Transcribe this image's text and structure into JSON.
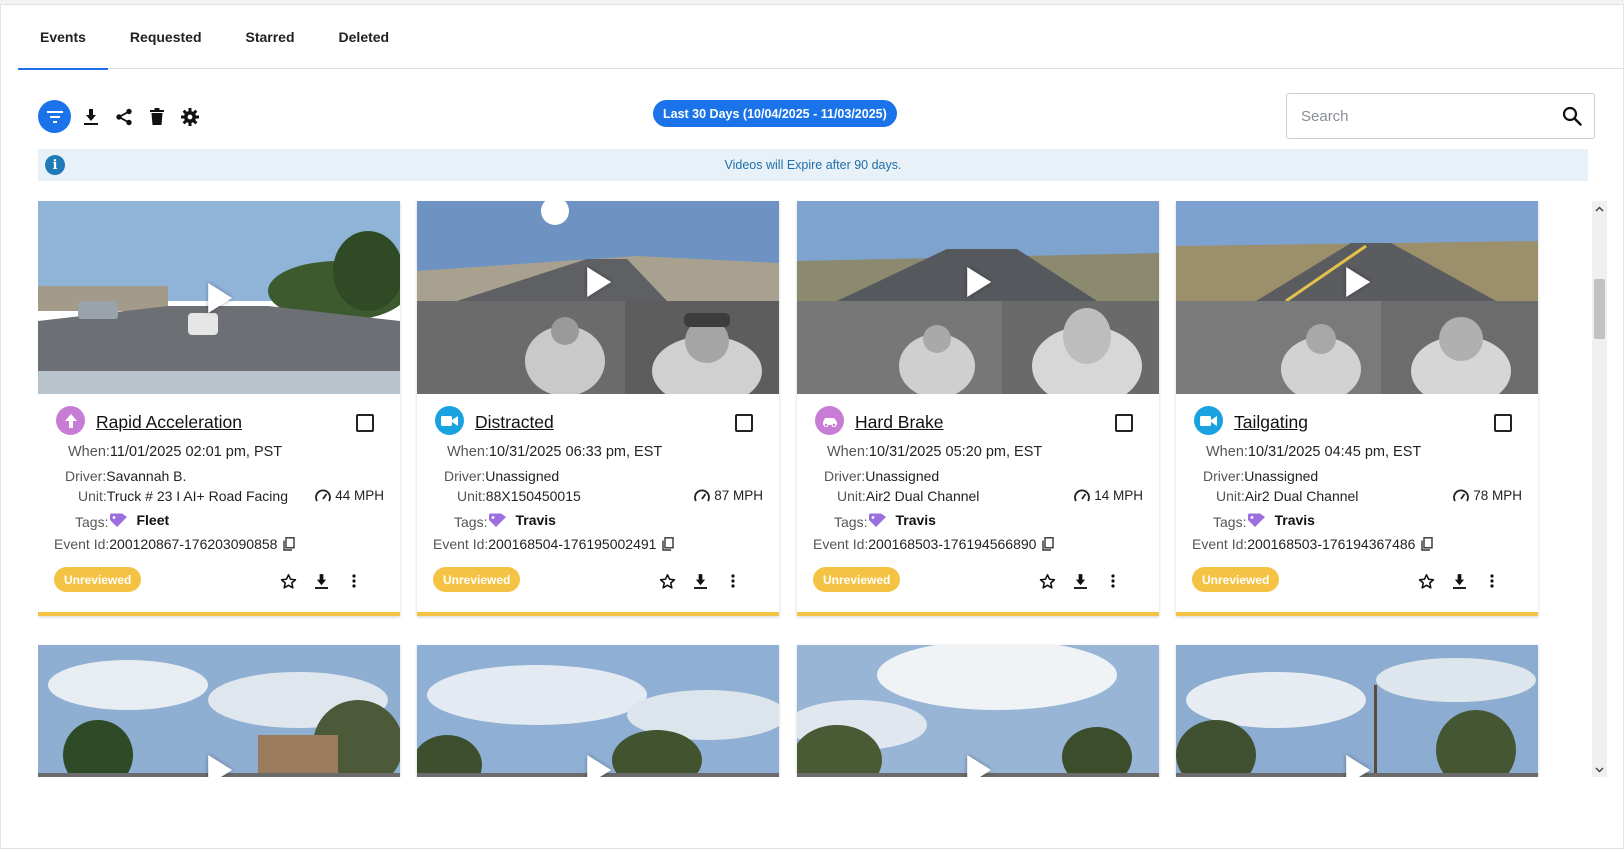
{
  "tabs": [
    {
      "label": "Events",
      "active": true
    },
    {
      "label": "Requested",
      "active": false
    },
    {
      "label": "Starred",
      "active": false
    },
    {
      "label": "Deleted",
      "active": false
    }
  ],
  "toolbar": {
    "icons": [
      "filter-icon",
      "download-icon",
      "share-icon",
      "delete-icon",
      "gear-icon"
    ],
    "date_range": "Last 30 Days (10/04/2025 - 11/03/2025)"
  },
  "search": {
    "placeholder": "Search",
    "value": ""
  },
  "banner": {
    "text": "Videos will Expire after 90 days."
  },
  "labels": {
    "when": "When:",
    "driver": "Driver:",
    "unit": "Unit:",
    "tags": "Tags:",
    "event_id": "Event Id:"
  },
  "events": [
    {
      "type": "Rapid Acceleration",
      "icon": "arrow-up-icon",
      "icon_color": "#c77dd6",
      "when": "11/01/2025 02:01 pm, PST",
      "driver": "Savannah B.",
      "unit": "Truck # 23 I AI+ Road Facing",
      "speed": "44 MPH",
      "tag": "Fleet",
      "event_id": "200120867-176203090858",
      "status": "Unreviewed"
    },
    {
      "type": "Distracted",
      "icon": "video-camera-icon",
      "icon_color": "#1aa1e0",
      "when": "10/31/2025 06:33 pm, EST",
      "driver": "Unassigned",
      "unit": "88X150450015",
      "speed": "87 MPH",
      "tag": "Travis",
      "event_id": "200168504-176195002491",
      "status": "Unreviewed"
    },
    {
      "type": "Hard Brake",
      "icon": "car-brake-icon",
      "icon_color": "#c77dd6",
      "when": "10/31/2025 05:20 pm, EST",
      "driver": "Unassigned",
      "unit": "Air2 Dual Channel",
      "speed": "14 MPH",
      "tag": "Travis",
      "event_id": "200168503-176194566890",
      "status": "Unreviewed"
    },
    {
      "type": "Tailgating",
      "icon": "video-camera-icon",
      "icon_color": "#1aa1e0",
      "when": "10/31/2025 04:45 pm, EST",
      "driver": "Unassigned",
      "unit": "Air2 Dual Channel",
      "speed": "78 MPH",
      "tag": "Travis",
      "event_id": "200168503-176194367486",
      "status": "Unreviewed"
    }
  ],
  "colors": {
    "accent": "#1a73e8",
    "status_unreviewed": "#f4c344",
    "tag_purple": "#9b6fe0",
    "banner_bg": "#e8f1f8"
  }
}
